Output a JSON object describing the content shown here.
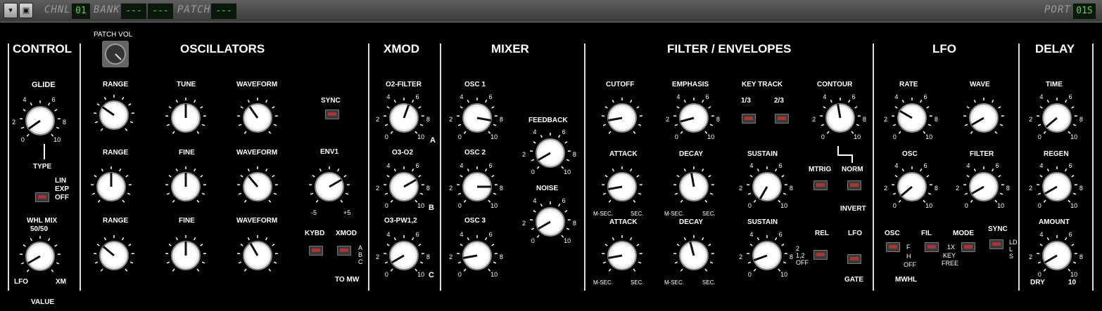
{
  "topbar": {
    "chnl_label": "CHNL",
    "chnl_value": "01",
    "bank_label": "BANK",
    "bank_value1": "---",
    "bank_value2": "---",
    "patch_label": "PATCH",
    "patch_value": "---",
    "port_label": "PORT",
    "port_value": "01S"
  },
  "patch_vol": "PATCH VOL",
  "sections": {
    "control": "CONTROL",
    "oscillators": "OSCILLATORS",
    "xmod": "XMOD",
    "mixer": "MIXER",
    "filter": "FILTER / ENVELOPES",
    "lfo": "LFO",
    "delay": "DELAY"
  },
  "control": {
    "glide": "GLIDE",
    "type": "TYPE",
    "lin": "LIN",
    "exp": "EXP",
    "off": "OFF",
    "whl_mix": "WHL MIX",
    "whl_mix_value": "50/50",
    "lfo": "LFO",
    "xm": "XM",
    "value": "VALUE"
  },
  "osc": {
    "range": "RANGE",
    "tune": "TUNE",
    "fine": "FINE",
    "waveform": "WAVEFORM",
    "sync": "SYNC",
    "env1": "ENV1",
    "env_min": "-5",
    "env_max": "+5",
    "kybd": "KYBD",
    "xmod": "XMOD",
    "abc": "A B C",
    "to_mw": "TO MW"
  },
  "xmod": {
    "o2_filter": "O2-FILTER",
    "o3_o2": "O3-O2",
    "o3_pw": "O3-PW1,2",
    "a": "A",
    "b": "B",
    "c": "C"
  },
  "mixer": {
    "osc1": "OSC 1",
    "osc2": "OSC 2",
    "osc3": "OSC 3",
    "feedback": "FEEDBACK",
    "noise": "NOISE"
  },
  "filter": {
    "cutoff": "CUTOFF",
    "emphasis": "EMPHASIS",
    "key_track": "KEY TRACK",
    "kt_13": "1/3",
    "kt_23": "2/3",
    "contour": "CONTOUR",
    "attack": "ATTACK",
    "decay": "DECAY",
    "sustain": "SUSTAIN",
    "mtrig": "MTRIG",
    "norm": "NORM",
    "invert": "INVERT",
    "rel": "REL",
    "lfo": "LFO",
    "gate": "GATE",
    "msec": "M-SEC.",
    "sec": "SEC.",
    "rel_opts": "2\n1,2\nOFF"
  },
  "lfo": {
    "rate": "RATE",
    "wave": "WAVE",
    "osc": "OSC",
    "filter": "FILTER",
    "osc_sw": "OSC",
    "fil_sw": "FIL",
    "mode": "MODE",
    "sync": "SYNC",
    "f": "F",
    "h": "H",
    "off": "OFF",
    "x1": "1X",
    "key": "KEY",
    "free": "FREE",
    "mwhl": "MWHL",
    "ldls": "LD L S"
  },
  "delay": {
    "time": "TIME",
    "regen": "REGEN",
    "amount": "AMOUNT",
    "dry": "DRY",
    "ten": "10"
  },
  "scale": {
    "zero": "0",
    "two": "2",
    "four": "4",
    "six": "6",
    "eight": "8",
    "ten": "10"
  }
}
